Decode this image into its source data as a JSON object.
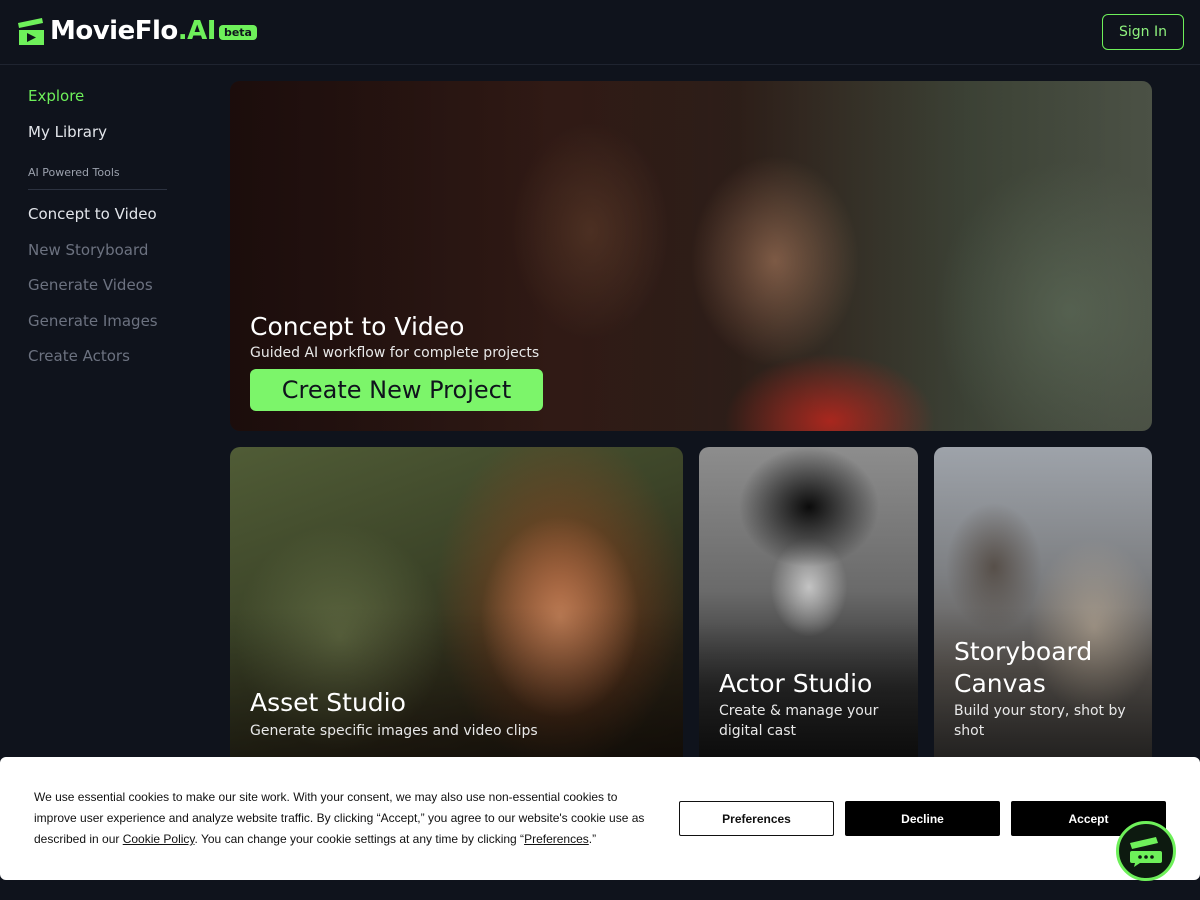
{
  "header": {
    "logo": {
      "name_main": "MovieFlo",
      "name_accent": ".AI",
      "badge": "beta"
    },
    "signin_label": "Sign In"
  },
  "sidebar": {
    "nav": [
      {
        "label": "Explore"
      },
      {
        "label": "My Library"
      }
    ],
    "section_label": "AI Powered Tools",
    "tools": [
      {
        "label": "Concept to Video"
      },
      {
        "label": "New Storyboard"
      },
      {
        "label": "Generate Videos"
      },
      {
        "label": "Generate Images"
      },
      {
        "label": "Create Actors"
      }
    ]
  },
  "cards": {
    "hero": {
      "title": "Concept to Video",
      "subtitle": "Guided AI workflow for complete projects",
      "cta": "Create New Project"
    },
    "asset": {
      "title": "Asset Studio",
      "subtitle": "Generate specific images and video clips"
    },
    "actor": {
      "title": "Actor Studio",
      "subtitle": "Create & manage your digital cast"
    },
    "storyboard": {
      "title": "Storyboard Canvas",
      "subtitle": "Build your story, shot by shot"
    }
  },
  "cookie": {
    "text_before": "We use essential cookies to make our site work. With your consent, we may also use non-essential cookies to improve user experience and analyze website traffic. By clicking “Accept,” you agree to our website's cookie use as described in our ",
    "policy_link": "Cookie Policy",
    "text_middle": ". You can change your cookie settings at any time by clicking “",
    "preferences_link": "Preferences",
    "text_end": ".”",
    "buttons": {
      "preferences": "Preferences",
      "decline": "Decline",
      "accept": "Accept"
    }
  },
  "colors": {
    "accent": "#6ef05a",
    "background": "#0f131c"
  },
  "icons": {
    "logo": "play-clapper-icon",
    "chat": "chat-bubble-icon"
  }
}
